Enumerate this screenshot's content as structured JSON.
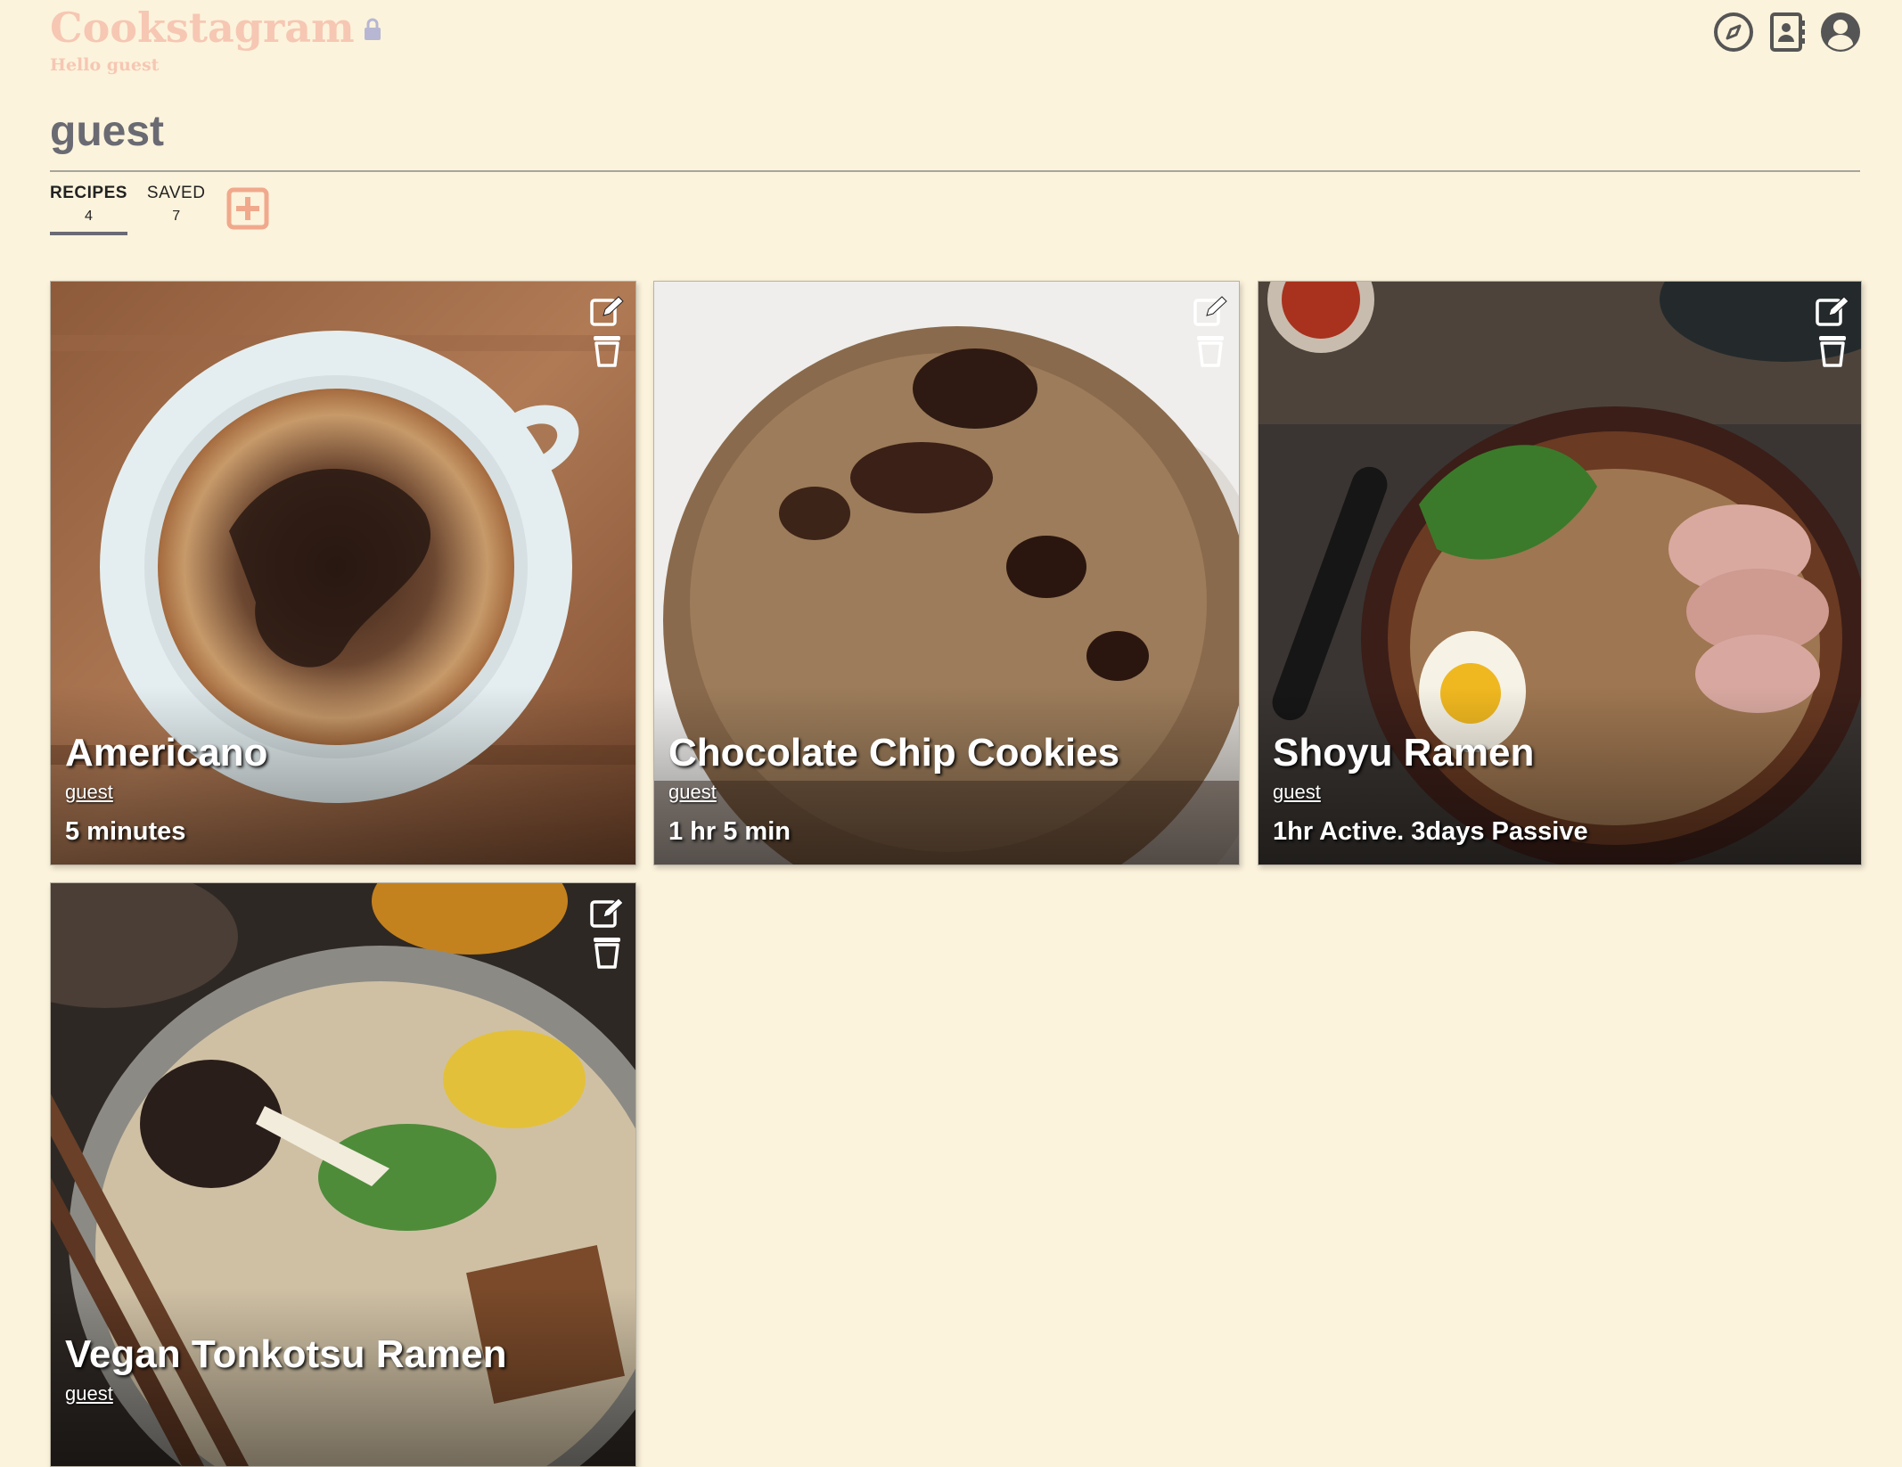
{
  "app": {
    "title": "Cookstagram",
    "greeting": "Hello guest"
  },
  "nav": {
    "icons": [
      "compass-icon",
      "contacts-icon",
      "user-circle-icon"
    ]
  },
  "profile": {
    "username": "guest"
  },
  "tabs": [
    {
      "label": "RECIPES",
      "count": "4",
      "active": true
    },
    {
      "label": "SAVED",
      "count": "7",
      "active": false
    }
  ],
  "colors": {
    "background": "#fcf3dc",
    "logo": "#f6c7b3",
    "accent": "#f0a98c",
    "text": "#6a6a73"
  },
  "recipes": [
    {
      "title": "Americano",
      "author": "guest",
      "time": "5 minutes",
      "image": "coffee cup"
    },
    {
      "title": "Chocolate Chip Cookies",
      "author": "guest",
      "time": "1 hr 5 min",
      "image": "chocolate chip cookie"
    },
    {
      "title": "Shoyu Ramen",
      "author": "guest",
      "time": "1hr Active. 3days Passive",
      "image": "shoyu ramen bowl"
    },
    {
      "title": "Vegan Tonkotsu Ramen",
      "author": "guest",
      "time": "",
      "image": "tonkotsu ramen bowl"
    }
  ]
}
